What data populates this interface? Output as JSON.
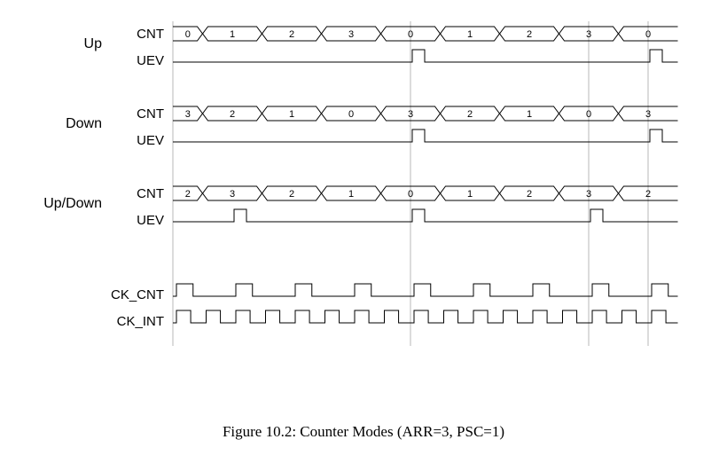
{
  "caption": "Figure 10.2: Counter Modes (ARR=3, PSC=1)",
  "modes": {
    "up": {
      "label": "Up",
      "cnt": "CNT",
      "uev": "UEV"
    },
    "down": {
      "label": "Down",
      "cnt": "CNT",
      "uev": "UEV"
    },
    "updown": {
      "label": "Up/Down",
      "cnt": "CNT",
      "uev": "UEV"
    }
  },
  "clocks": {
    "ck_cnt": "CK_CNT",
    "ck_int": "CK_INT"
  },
  "chart_data": {
    "type": "timing",
    "time_slots": 9,
    "guides": [
      0,
      4,
      7,
      8
    ],
    "tracks": [
      {
        "mode": "Up",
        "row": "CNT",
        "values": [
          0,
          1,
          2,
          3,
          0,
          1,
          2,
          3,
          0
        ]
      },
      {
        "mode": "Up",
        "row": "UEV",
        "pulses_at": [
          4,
          8
        ]
      },
      {
        "mode": "Down",
        "row": "CNT",
        "values": [
          3,
          2,
          1,
          0,
          3,
          2,
          1,
          0,
          3
        ]
      },
      {
        "mode": "Down",
        "row": "UEV",
        "pulses_at": [
          4,
          8
        ]
      },
      {
        "mode": "Up/Down",
        "row": "CNT",
        "values": [
          2,
          3,
          2,
          1,
          0,
          1,
          2,
          3,
          2
        ]
      },
      {
        "mode": "Up/Down",
        "row": "UEV",
        "pulses_at": [
          1,
          4,
          7
        ]
      },
      {
        "row": "CK_CNT",
        "period_slots": 1,
        "high_fraction": 0.28
      },
      {
        "row": "CK_INT",
        "period_slots": 0.5,
        "high_fraction": 0.48
      }
    ]
  }
}
